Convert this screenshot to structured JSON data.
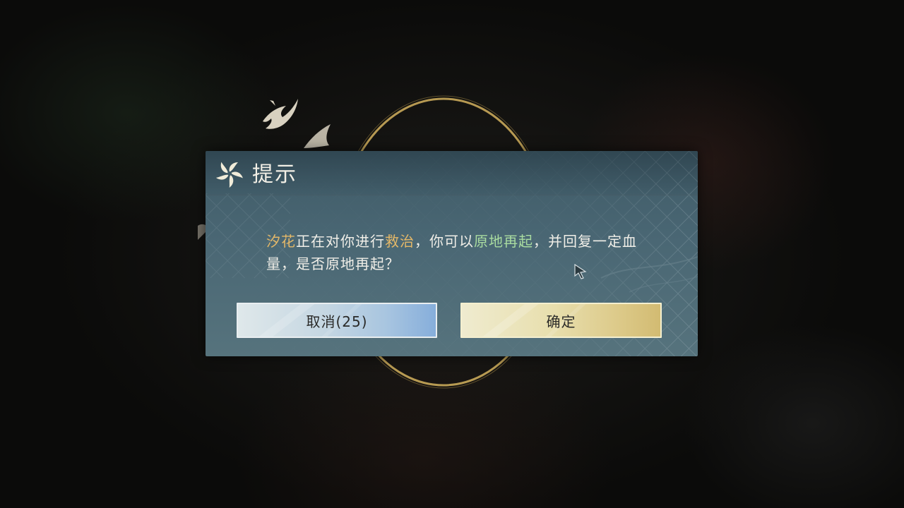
{
  "dialog": {
    "title": "提示",
    "message": {
      "name": "汐花",
      "part1": "正在对你进行",
      "action": "救治",
      "part2": "，你可以",
      "highlight": "原地再起",
      "part3": "，并回复一定血量，是否原地再起？"
    },
    "buttons": {
      "cancel_label": "取消(25)",
      "confirm_label": "确定"
    }
  },
  "colors": {
    "name": "#e4b868",
    "action": "#e4b868",
    "highlight": "#a9dca0",
    "dialog_bg": "#496673",
    "cancel_button": "#a8c5e0",
    "confirm_button": "#e8dfae",
    "ring": "#c9a85a"
  },
  "icons": {
    "header": "pinwheel-icon",
    "cursor": "pointer-cursor-icon"
  }
}
